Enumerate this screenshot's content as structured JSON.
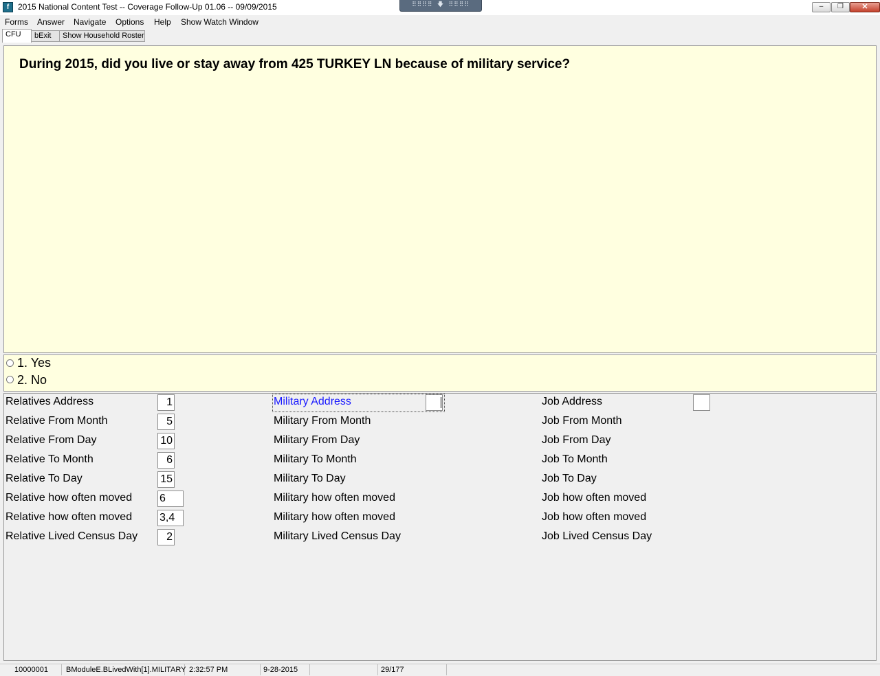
{
  "window": {
    "title": "2015 National Content Test -- Coverage Follow-Up 01.06 -- 09/09/2015",
    "app_icon": "app-icon",
    "remote_bar": "⠿⠿⠿⠿ 🡇 ⠿⠿⠿⠿",
    "controls": {
      "minimize": "–",
      "restore": "❐",
      "close": "✕"
    }
  },
  "menu": [
    "Forms",
    "Answer",
    "Navigate",
    "Options",
    "Help",
    "Show Watch Window"
  ],
  "tabs": [
    "CFU",
    "bExit",
    "Show Household Roster"
  ],
  "question": "During 2015, did you live or stay away from 425 TURKEY LN because of military service?",
  "answers": [
    "1. Yes",
    "2. No"
  ],
  "fields": {
    "relative": [
      {
        "label": "Relatives Address",
        "value": "1"
      },
      {
        "label": "Relative From Month",
        "value": "5"
      },
      {
        "label": "Relative From Day",
        "value": "10"
      },
      {
        "label": "Relative To Month",
        "value": "6"
      },
      {
        "label": "Relative To Day",
        "value": "15"
      },
      {
        "label": "Relative how often moved",
        "value": "6"
      },
      {
        "label": "Relative how often moved",
        "value": "3,4"
      },
      {
        "label": "Relative Lived Census Day",
        "value": "2"
      }
    ],
    "military": [
      {
        "label": "Military Address",
        "value": ""
      },
      {
        "label": "Military From Month"
      },
      {
        "label": "Military From Day"
      },
      {
        "label": "Military To Month"
      },
      {
        "label": "Military To Day"
      },
      {
        "label": "Military how often moved"
      },
      {
        "label": "Military how often moved"
      },
      {
        "label": "Military Lived Census Day"
      }
    ],
    "job": [
      {
        "label": "Job Address",
        "value": ""
      },
      {
        "label": "Job From Month"
      },
      {
        "label": "Job From Day"
      },
      {
        "label": "Job To Month"
      },
      {
        "label": "Job To Day"
      },
      {
        "label": "Job how often moved"
      },
      {
        "label": "Job how often moved"
      },
      {
        "label": "Job Lived Census Day"
      }
    ]
  },
  "colors": {
    "active_field_label": "#1a1aff",
    "question_bg": "#ffffe0"
  },
  "status": {
    "case_id": "10000001",
    "field_path": "BModuleE.BLivedWith[1].MILITARY",
    "time": "2:32:57 PM",
    "date": "9-28-2015",
    "blank": "",
    "progress": "29/177"
  }
}
